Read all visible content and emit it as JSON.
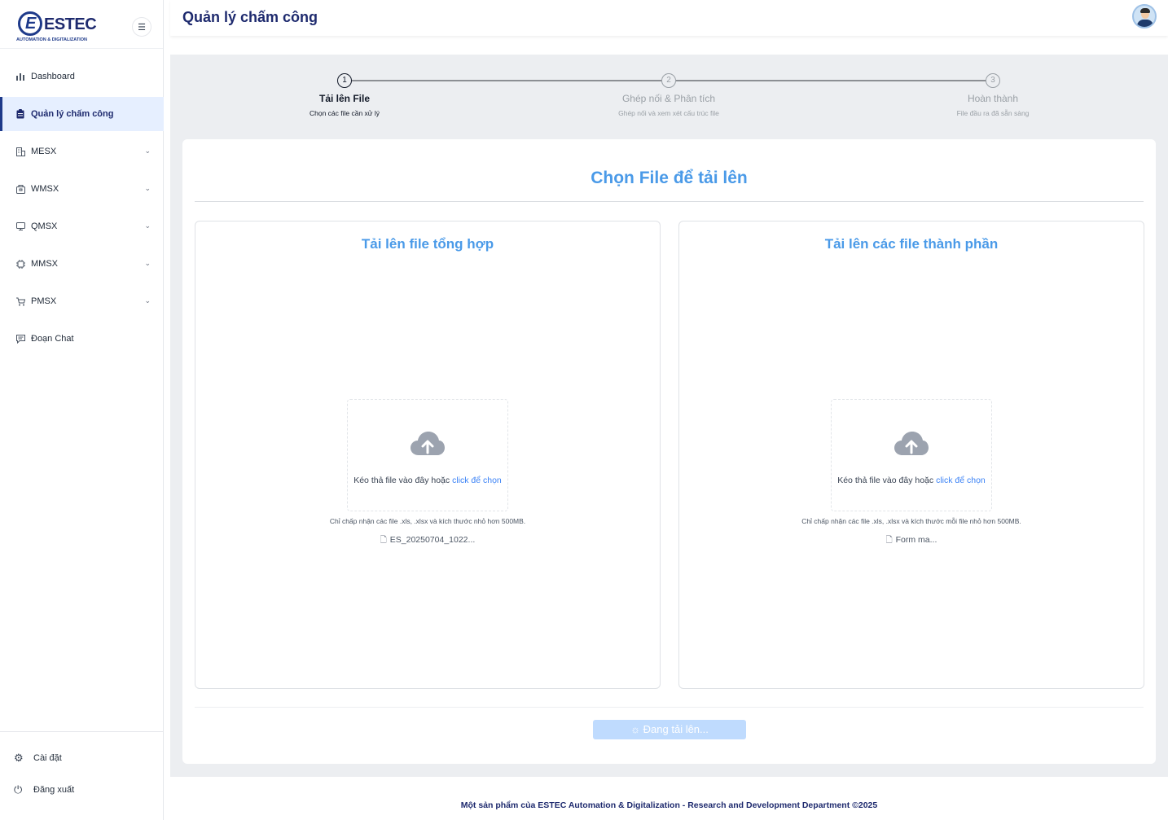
{
  "brand": {
    "name": "ESTEC",
    "tagline": "AUTOMATION & DIGITALIZATION"
  },
  "header": {
    "title": "Quản lý chấm công"
  },
  "sidebar": {
    "items": [
      {
        "label": "Dashboard",
        "icon": "bar-chart-icon"
      },
      {
        "label": "Quản lý chấm công",
        "icon": "clipboard-icon",
        "active": true
      },
      {
        "label": "MESX",
        "icon": "building-icon",
        "expandable": true
      },
      {
        "label": "WMSX",
        "icon": "package-icon",
        "expandable": true
      },
      {
        "label": "QMSX",
        "icon": "monitor-icon",
        "expandable": true
      },
      {
        "label": "MMSX",
        "icon": "chip-icon",
        "expandable": true
      },
      {
        "label": "PMSX",
        "icon": "cart-icon",
        "expandable": true
      },
      {
        "label": "Đoạn Chat",
        "icon": "chat-icon"
      }
    ],
    "bottom": [
      {
        "label": "Cài đặt",
        "icon": "gear-icon"
      },
      {
        "label": "Đăng xuất",
        "icon": "power-icon"
      }
    ]
  },
  "steps": [
    {
      "num": "1",
      "label": "Tải lên File",
      "sub": "Chọn các file cần xử lý",
      "state": "current"
    },
    {
      "num": "2",
      "label": "Ghép nối & Phân tích",
      "sub": "Ghép nối và xem xét cấu trúc file",
      "state": "pending"
    },
    {
      "num": "3",
      "label": "Hoàn thành",
      "sub": "File đầu ra đã sẵn sàng",
      "state": "pending"
    }
  ],
  "card": {
    "title": "Chọn File để tải lên",
    "left_panel": {
      "title": "Tải lên file tổng hợp",
      "drop_text": "Kéo thả file vào đây hoặc ",
      "drop_link": "click để chọn",
      "hint": "Chỉ chấp nhận các file .xls, .xlsx và kích thước nhỏ hơn 500MB.",
      "file_name": "ES_20250704_1022..."
    },
    "right_panel": {
      "title": "Tải lên các file thành phần",
      "drop_text": "Kéo thả file vào đây hoặc ",
      "drop_link": "click để chọn",
      "hint": "Chỉ chấp nhận các file .xls, .xlsx và kích thước mỗi file nhỏ hơn 500MB.",
      "file_name": "Form ma..."
    },
    "upload_button": "Đang tải lên...",
    "upload_icon": "spinner-icon"
  },
  "footer": {
    "text": "Một sản phẩm của ESTEC Automation & Digitalization - Research and Development Department ©2025"
  },
  "colors": {
    "accent": "#4a9ae8",
    "brand": "#1e2a6e",
    "active_bg": "#e6efff",
    "button_disabled": "#bfdbfe"
  }
}
